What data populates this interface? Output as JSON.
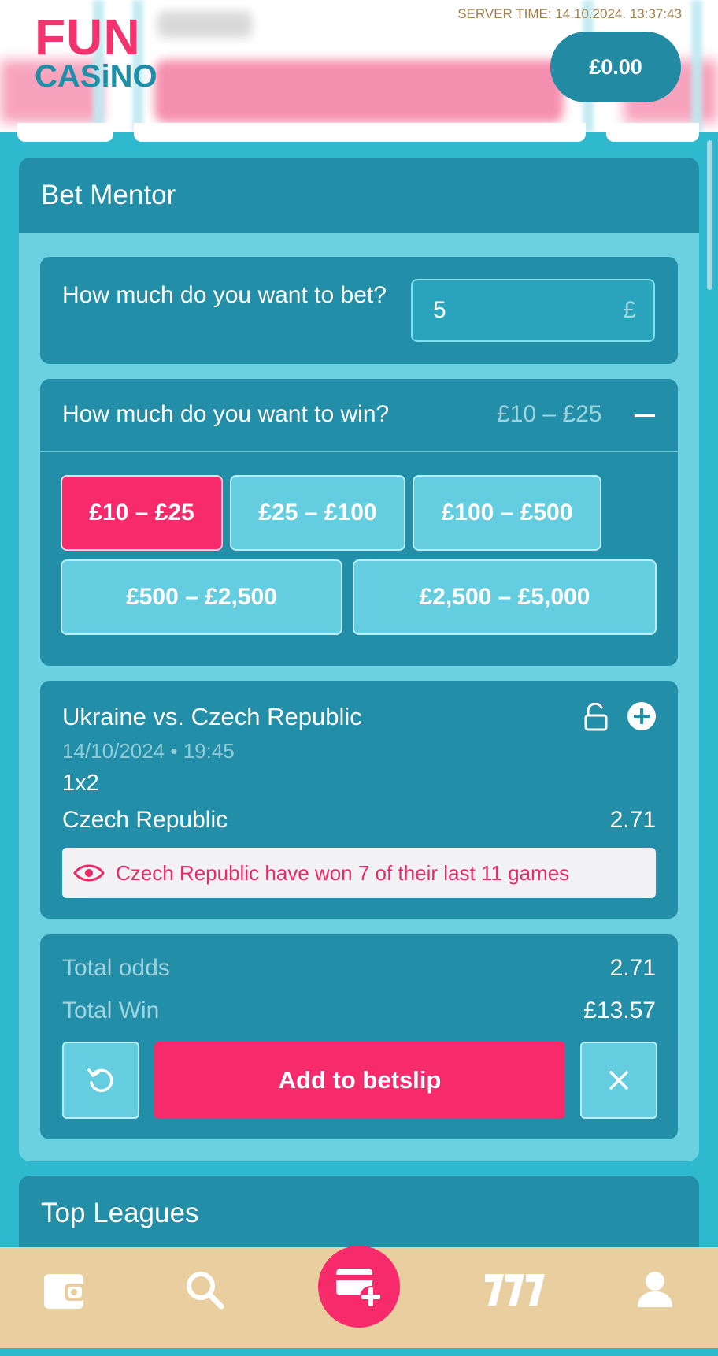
{
  "header": {
    "logo_line1": "FUN",
    "logo_line2": "CASiNO",
    "server_time": "SERVER TIME: 14.10.2024. 13:37:43",
    "balance": "£0.00"
  },
  "bet_mentor": {
    "title": "Bet Mentor",
    "bet_question": "How much do you want to bet?",
    "bet_value": "5",
    "currency": "£",
    "win_question": "How much do you want to win?",
    "win_selected": "£10 – £25",
    "win_options": [
      "£10 – £25",
      "£25 – £100",
      "£100 – £500",
      "£500 – £2,500",
      "£2,500 – £5,000"
    ],
    "match": {
      "title": "Ukraine vs. Czech Republic",
      "datetime": "14/10/2024 • 19:45",
      "market": "1x2",
      "selection": "Czech Republic",
      "odds": "2.71",
      "tip": "Czech Republic have won 7 of their last 11 games"
    },
    "totals": {
      "odds_label": "Total odds",
      "odds_value": "2.71",
      "win_label": "Total Win",
      "win_value": "£13.57",
      "add_label": "Add to betslip"
    }
  },
  "top_leagues": {
    "title": "Top Leagues"
  },
  "nav": {
    "items": [
      "wallet-icon",
      "search-icon",
      "betslip-add-icon",
      "slots-777-icon",
      "user-icon"
    ]
  },
  "colors": {
    "brand_pink": "#f72a6c",
    "panel_teal": "#238ea7",
    "background_teal": "#2fb9cf",
    "nav_sand": "#e9cea0"
  }
}
